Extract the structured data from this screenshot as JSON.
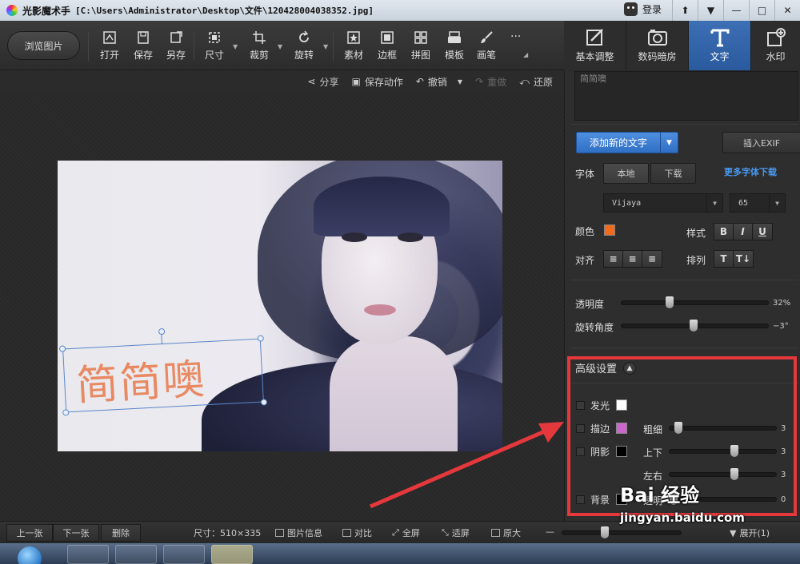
{
  "window": {
    "app_name": "光影魔术手",
    "path": "[C:\\Users\\Administrator\\Desktop\\文件\\120428004038352.jpg]",
    "login_label": "登录",
    "buttons": [
      "⬆",
      "▼",
      "—",
      "□",
      "✕"
    ]
  },
  "toolbar": {
    "browse_label": "浏览图片",
    "items": [
      {
        "label": "打开",
        "icon": "open-icon"
      },
      {
        "label": "保存",
        "icon": "save-icon"
      },
      {
        "label": "另存",
        "icon": "save-as-icon"
      },
      {
        "label": "尺寸",
        "icon": "resize-icon"
      },
      {
        "label": "裁剪",
        "icon": "crop-icon"
      },
      {
        "label": "旋转",
        "icon": "rotate-icon"
      },
      {
        "label": "素材",
        "icon": "material-icon"
      },
      {
        "label": "边框",
        "icon": "frame-icon"
      },
      {
        "label": "拼图",
        "icon": "collage-icon"
      },
      {
        "label": "模板",
        "icon": "template-icon"
      },
      {
        "label": "画笔",
        "icon": "brush-icon"
      }
    ],
    "more": "···"
  },
  "tabs": [
    {
      "label": "基本调整",
      "icon": "basic-adjust-icon",
      "active": false
    },
    {
      "label": "数码暗房",
      "icon": "camera-icon",
      "active": false
    },
    {
      "label": "文字",
      "icon": "text-icon",
      "active": true
    },
    {
      "label": "水印",
      "icon": "watermark-icon",
      "active": false
    }
  ],
  "actions": {
    "share": "分享",
    "save_action": "保存动作",
    "undo": "撤销",
    "redo": "重做",
    "restore": "还原"
  },
  "canvas": {
    "overlay_text": "简简噢"
  },
  "panel": {
    "text_value": "简简噢",
    "add_text": "添加新的文字",
    "insert_exif": "插入EXIF",
    "font_label": "字体",
    "font_tab_local": "本地",
    "font_tab_download": "下载",
    "more_fonts": "更多字体下载",
    "font_name": "Vijaya",
    "font_size": "65",
    "color_label": "颜色",
    "color_value": "#f26b1d",
    "style_label": "样式",
    "style_buttons": [
      "B",
      "I",
      "U"
    ],
    "align_label": "对齐",
    "arrange_label": "排列",
    "opacity_label": "透明度",
    "opacity_value": "32%",
    "opacity_fraction": 0.32,
    "rotation_label": "旋转角度",
    "rotation_value": "−3°",
    "rotation_fraction": 0.49,
    "advanced_label": "高级设置",
    "glow_label": "发光",
    "glow_color": "#ffffff",
    "stroke_label": "描边",
    "stroke_color": "#cc66cc",
    "thickness_label": "粗细",
    "thickness_value": "3",
    "thickness_fraction": 0.05,
    "shadow_label": "阴影",
    "shadow_color": "#000000",
    "updown_label": "上下",
    "updown_value": "3",
    "updown_fraction": 0.62,
    "leftright_label": "左右",
    "leftright_value": "3",
    "leftright_fraction": 0.62,
    "background_label": "背景",
    "background_color": "#000000",
    "bg_opacity_label": "透明",
    "bg_opacity_value": "0",
    "bg_opacity_fraction": 0.0
  },
  "bottom": {
    "prev": "上一张",
    "next": "下一张",
    "delete": "删除",
    "size": "尺寸：510×335",
    "info": "图片信息",
    "compare": "对比",
    "fullscreen": "全屏",
    "fit": "适屏",
    "original": "原大",
    "expand": "展开(1)"
  },
  "watermark": {
    "brand": "Bai 经验",
    "url": "jingyan.baidu.com"
  },
  "colors": {
    "accent": "#3d6fb4",
    "annotation_red": "#e5383c",
    "text_orange": "#e8845a"
  }
}
